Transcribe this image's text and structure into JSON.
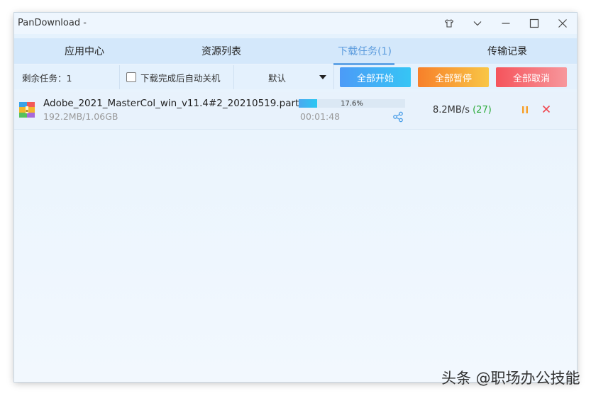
{
  "window": {
    "title": "PanDownload -"
  },
  "title_controls": [
    "shirt-icon",
    "chevron-down-icon",
    "minimize-icon",
    "maximize-icon",
    "close-icon"
  ],
  "tabs": [
    {
      "label": "应用中心",
      "active": false
    },
    {
      "label": "资源列表",
      "active": false
    },
    {
      "label": "下载任务(1)",
      "active": true
    },
    {
      "label": "传输记录",
      "active": false
    }
  ],
  "toolbar": {
    "remaining_label": "剩余任务：1",
    "auto_shutdown_label": "下载完成后自动关机",
    "auto_shutdown_checked": false,
    "priority_select": "默认",
    "start_all": "全部开始",
    "pause_all": "全部暂停",
    "cancel_all": "全部取消"
  },
  "colors": {
    "accent": "#62a4e6",
    "start_all": "#58a7f5",
    "pause_all": "#f7a02a",
    "cancel_all": "#f56b72",
    "connections_green": "#2cab3a"
  },
  "downloads": [
    {
      "filename": "Adobe_2021_MasterCol_win_v11.4#2_20210519.part0...",
      "size": "192.2MB/1.06GB",
      "progress_text": "17.6%",
      "progress": 0.176,
      "elapsed": "00:01:48",
      "speed": "8.2MB/s",
      "connections": "(27)"
    }
  ],
  "watermark": "头条 @职场办公技能"
}
